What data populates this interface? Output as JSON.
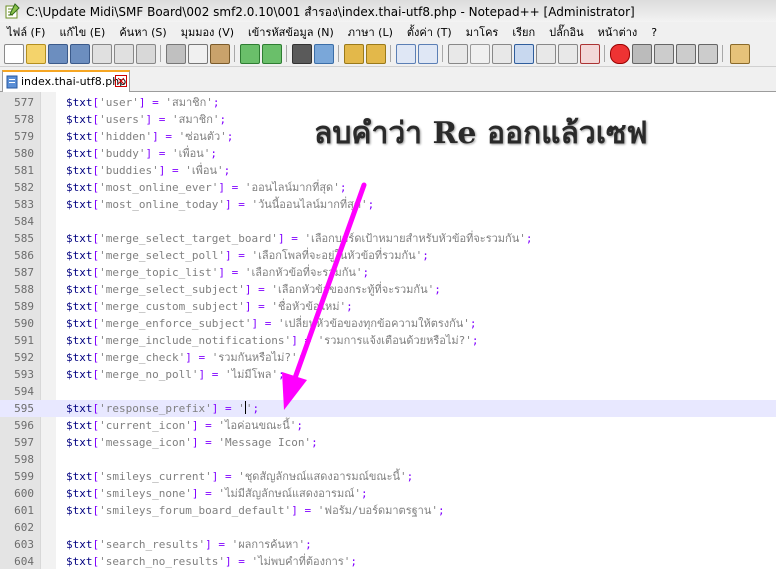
{
  "window": {
    "title": "C:\\Update Midi\\SMF Board\\002 smf2.0.10\\001 สำรอง\\index.thai-utf8.php - Notepad++ [Administrator]"
  },
  "menu": [
    "ไฟล์ (F)",
    "แก้ไข (E)",
    "ค้นหา (S)",
    "มุมมอง (V)",
    "เข้ารหัสข้อมูล (N)",
    "ภาษา (L)",
    "ตั้งค่า (T)",
    "มาโคร",
    "เรียก",
    "ปลั๊กอิน",
    "หน้าต่าง",
    "?"
  ],
  "tab": {
    "label": "index.thai-utf8.php"
  },
  "annotation": "ลบคำว่า Re ออกแล้วเซฟ",
  "lines": [
    {
      "num": "577",
      "key": "user",
      "val": "สมาชิก"
    },
    {
      "num": "578",
      "key": "users",
      "val": "สมาชิก"
    },
    {
      "num": "579",
      "key": "hidden",
      "val": "ซ่อนตัว"
    },
    {
      "num": "580",
      "key": "buddy",
      "val": "เพื่อน"
    },
    {
      "num": "581",
      "key": "buddies",
      "val": "เพื่อน"
    },
    {
      "num": "582",
      "key": "most_online_ever",
      "val": "ออนไลน์มากที่สุด"
    },
    {
      "num": "583",
      "key": "most_online_today",
      "val": "วันนี้ออนไลน์มากที่สุด"
    },
    {
      "num": "584",
      "key": "",
      "val": ""
    },
    {
      "num": "585",
      "key": "merge_select_target_board",
      "val": "เลือกบอร์ดเป้าหมายสำหรับหัวข้อที่จะรวมกัน"
    },
    {
      "num": "586",
      "key": "merge_select_poll",
      "val": "เลือกโพลที่จะอยู่ในหัวข้อที่รวมกัน"
    },
    {
      "num": "587",
      "key": "merge_topic_list",
      "val": "เลือกหัวข้อที่จะรวมกัน"
    },
    {
      "num": "588",
      "key": "merge_select_subject",
      "val": "เลือกหัวข้อของกระทู้ที่จะรวมกัน"
    },
    {
      "num": "589",
      "key": "merge_custom_subject",
      "val": "ชื่อหัวข้อใหม่"
    },
    {
      "num": "590",
      "key": "merge_enforce_subject",
      "val": "เปลี่ยนหัวข้อของทุกข้อความให้ตรงกัน"
    },
    {
      "num": "591",
      "key": "merge_include_notifications",
      "val": "รวมการแจ้งเตือนด้วยหรือไม่?"
    },
    {
      "num": "592",
      "key": "merge_check",
      "val": "รวมกันหรือไม่?"
    },
    {
      "num": "593",
      "key": "merge_no_poll",
      "val": "ไม่มีโพล"
    },
    {
      "num": "594",
      "key": "",
      "val": ""
    },
    {
      "num": "595",
      "key": "response_prefix",
      "val": ""
    },
    {
      "num": "596",
      "key": "current_icon",
      "val": "ไอค่อนขณะนี้"
    },
    {
      "num": "597",
      "key": "message_icon",
      "val": "Message Icon"
    },
    {
      "num": "598",
      "key": "",
      "val": ""
    },
    {
      "num": "599",
      "key": "smileys_current",
      "val": "ชุดสัญลักษณ์แสดงอารมณ์ขณะนี้"
    },
    {
      "num": "600",
      "key": "smileys_none",
      "val": "ไม่มีสัญลักษณ์แสดงอารมณ์"
    },
    {
      "num": "601",
      "key": "smileys_forum_board_default",
      "val": "ฟอรัม/บอร์ดมาตรฐาน"
    },
    {
      "num": "602",
      "key": "",
      "val": ""
    },
    {
      "num": "603",
      "key": "search_results",
      "val": "ผลการค้นหา"
    },
    {
      "num": "604",
      "key": "search_no_results",
      "val": "ไม่พบคำที่ต้องการ"
    }
  ],
  "current_line": "595",
  "colors": {
    "annotation_arrow": "#ff00ff",
    "variable": "#000080",
    "string": "#808080",
    "operator": "#8000ff"
  }
}
